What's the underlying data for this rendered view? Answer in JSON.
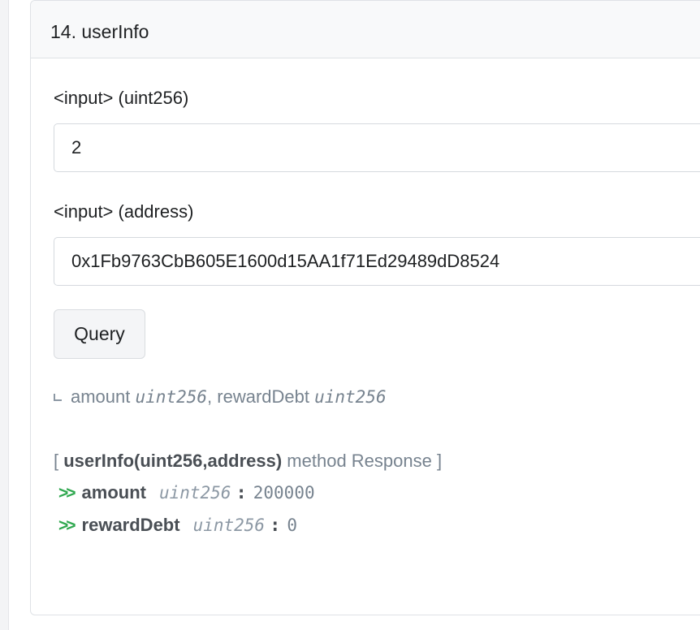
{
  "card": {
    "title": "14. userInfo"
  },
  "inputs": [
    {
      "label": "<input> (uint256)",
      "value": "2"
    },
    {
      "label": "<input> (address)",
      "value": "0x1Fb9763CbB605E1600d15AA1f71Ed29489dD8524"
    }
  ],
  "query_button": {
    "label": "Query"
  },
  "outputs": {
    "first_name": "amount",
    "first_type": "uint256",
    "separator": ", ",
    "second_name": "rewardDebt",
    "second_type": "uint256"
  },
  "response": {
    "open_bracket": "[ ",
    "signature": "userInfo(uint256,address)",
    "suffix": " method Response ]",
    "rows": [
      {
        "name": "amount",
        "type": "uint256",
        "colon": ":",
        "value": "200000"
      },
      {
        "name": "rewardDebt",
        "type": "uint256",
        "colon": ":",
        "value": "0"
      }
    ]
  },
  "icons": {
    "output_corner": "corner-down-right-icon",
    "response_arrow": "double-chevron-right-icon"
  },
  "colors": {
    "accent_green": "#2fa84f",
    "muted_text": "#77838f",
    "header_bg": "#f8f9fa"
  }
}
